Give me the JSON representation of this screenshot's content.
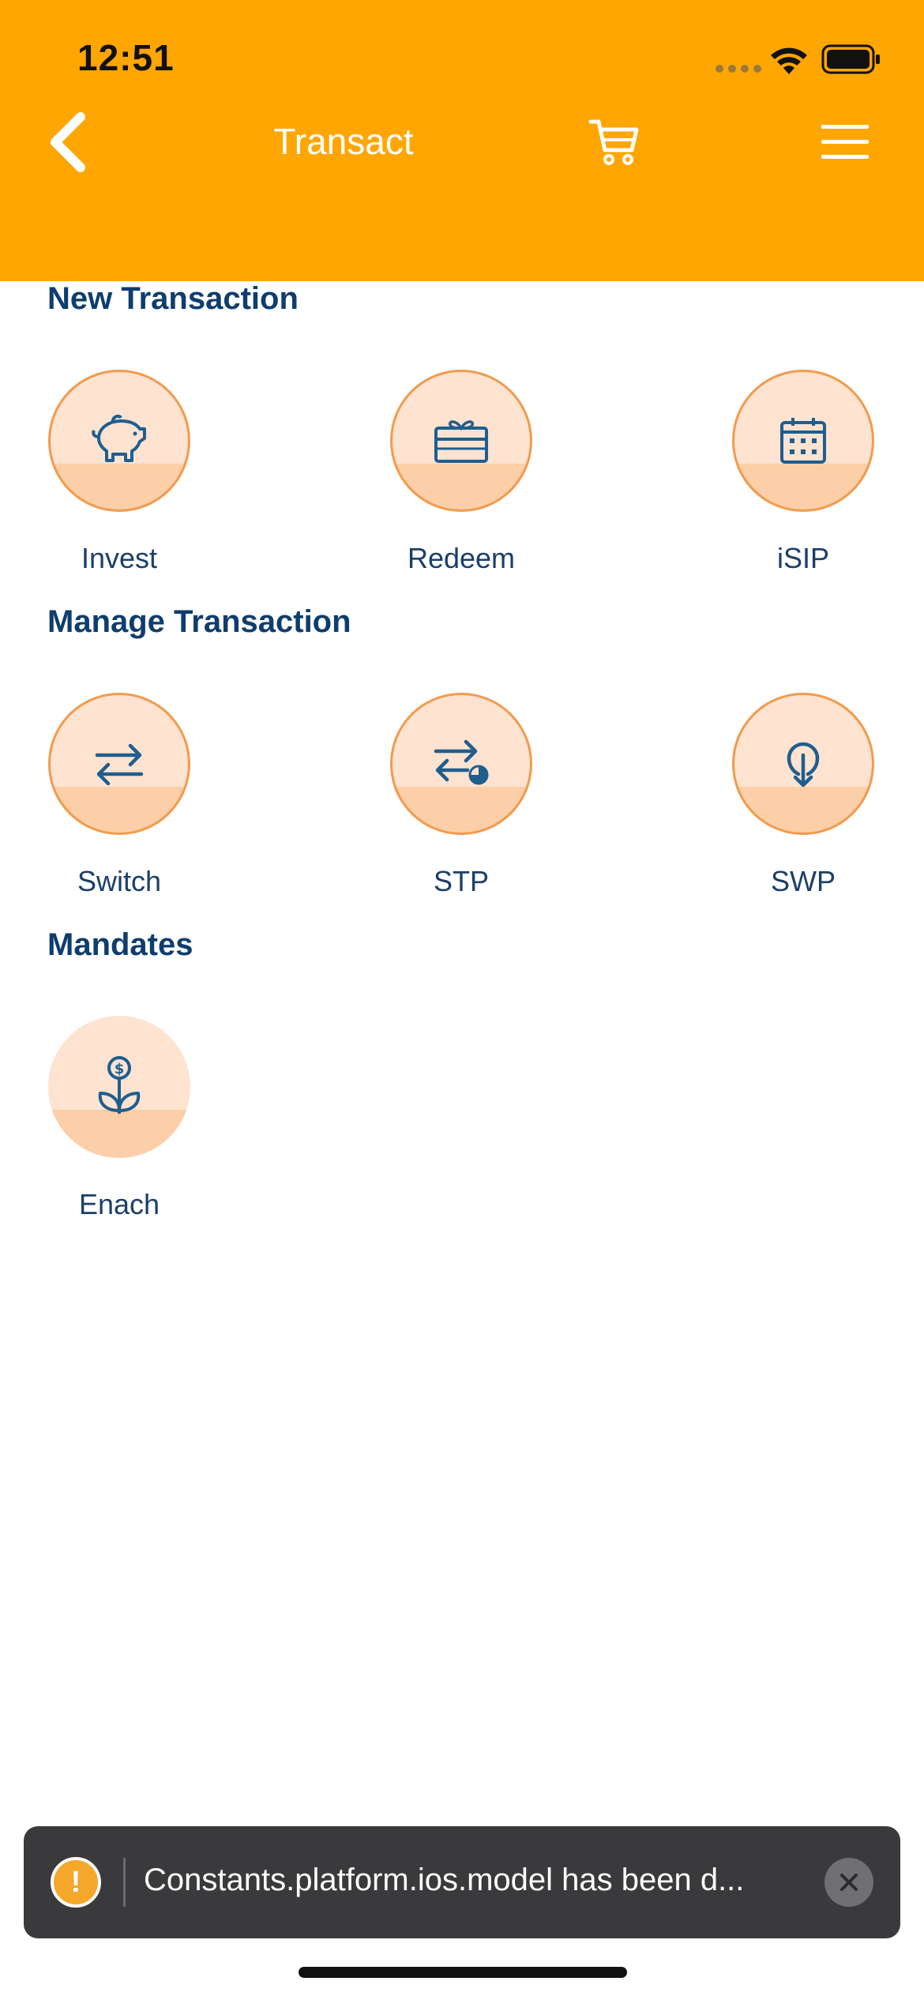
{
  "status_bar": {
    "time": "12:51"
  },
  "nav": {
    "title": "Transact",
    "back_icon": "chevron-left-icon",
    "cart_icon": "cart-icon",
    "menu_icon": "hamburger-menu-icon"
  },
  "colors": {
    "header": "#FFA602",
    "title_blue": "#0E3D6E",
    "circle_light": "#FEE3D0",
    "circle_dark": "#FCCFA8",
    "icon_blue": "#1F5E8F",
    "ring_orange": "#F29B4E"
  },
  "sections": [
    {
      "title": "New Transaction",
      "items": [
        {
          "label": "Invest",
          "icon": "piggy-bank-icon"
        },
        {
          "label": "Redeem",
          "icon": "gift-card-icon"
        },
        {
          "label": "iSIP",
          "icon": "calendar-icon"
        }
      ]
    },
    {
      "title": "Manage Transaction",
      "items": [
        {
          "label": "Switch",
          "icon": "swap-arrows-icon"
        },
        {
          "label": "STP",
          "icon": "swap-clock-icon"
        },
        {
          "label": "SWP",
          "icon": "withdraw-arrow-icon"
        }
      ]
    },
    {
      "title": "Mandates",
      "items": [
        {
          "label": "Enach",
          "icon": "money-plant-icon"
        }
      ]
    }
  ],
  "toast": {
    "message": "Constants.platform.ios.model has been d...",
    "icon": "warning-icon",
    "close_icon": "close-icon"
  }
}
